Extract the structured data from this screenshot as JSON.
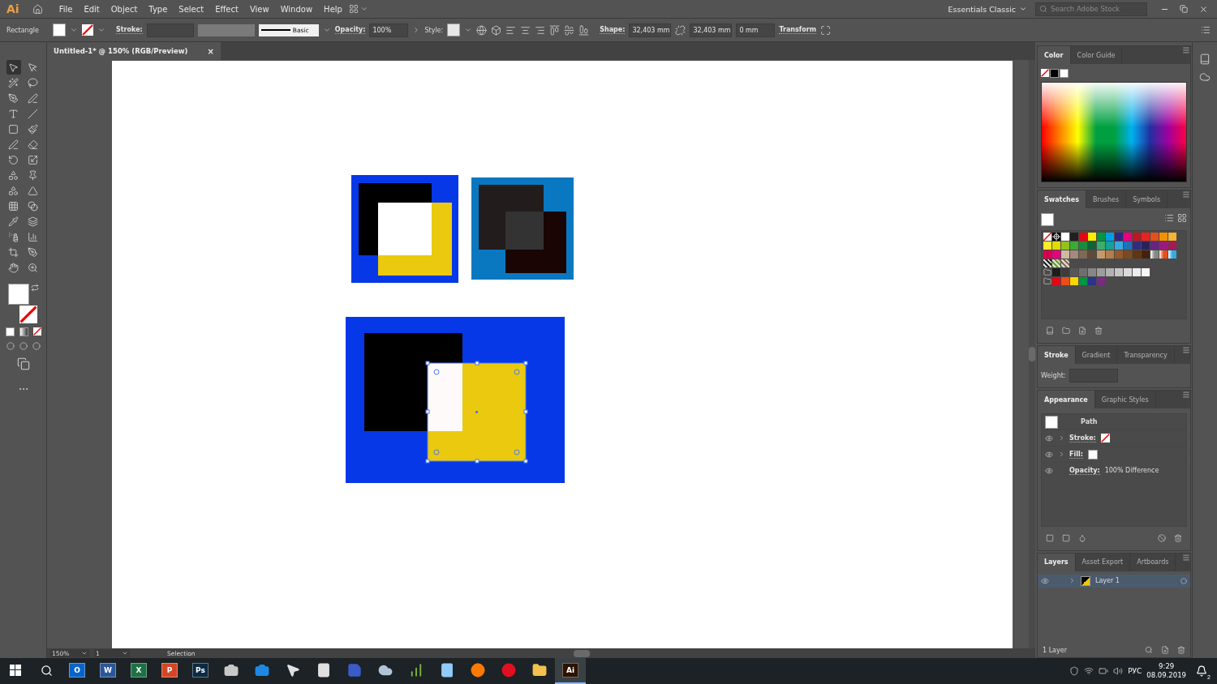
{
  "app": {
    "logo": "Ai",
    "menu": [
      "File",
      "Edit",
      "Object",
      "Type",
      "Select",
      "Effect",
      "View",
      "Window",
      "Help"
    ],
    "workspace": "Essentials Classic",
    "search": {
      "placeholder": "Search Adobe Stock"
    }
  },
  "control_bar": {
    "object_type": "Rectangle",
    "stroke_label": "Stroke:",
    "brush": "Basic",
    "opacity_label": "Opacity:",
    "opacity": "100%",
    "style_label": "Style:",
    "shape_label": "Shape:",
    "width": "32,403 mm",
    "height": "32,403 mm",
    "corner": "0 mm",
    "transform": "Transform"
  },
  "document_tab": {
    "title": "Untitled-1* @ 150% (RGB/Preview)",
    "close": "×"
  },
  "color_panel": {
    "tabs": [
      {
        "label": "Color",
        "selected": true
      },
      {
        "label": "Color Guide",
        "selected": false
      }
    ]
  },
  "swatches_panel": {
    "tabs": [
      {
        "label": "Swatches",
        "selected": true
      },
      {
        "label": "Brushes",
        "selected": false
      },
      {
        "label": "Symbols",
        "selected": false
      }
    ],
    "rows": [
      {
        "kind": "plain",
        "swatches": [
          {
            "kind": "none",
            "color": "#ffffff"
          },
          {
            "kind": "registration",
            "color": "#000000"
          },
          {
            "kind": "solid",
            "color": "#ffffff"
          },
          {
            "kind": "solid",
            "color": "#231f20"
          },
          {
            "kind": "solid",
            "color": "#e30613"
          },
          {
            "kind": "solid",
            "color": "#ffed00"
          },
          {
            "kind": "solid",
            "color": "#009640"
          },
          {
            "kind": "solid",
            "color": "#009fe3"
          },
          {
            "kind": "solid",
            "color": "#312783"
          },
          {
            "kind": "solid",
            "color": "#e6007e"
          },
          {
            "kind": "solid",
            "color": "#be1622"
          },
          {
            "kind": "solid",
            "color": "#e52521"
          },
          {
            "kind": "solid",
            "color": "#e94e1b"
          },
          {
            "kind": "solid",
            "color": "#f39200"
          },
          {
            "kind": "solid",
            "color": "#f9b233"
          }
        ]
      },
      {
        "kind": "plain",
        "swatches": [
          {
            "kind": "solid",
            "color": "#fcea2b"
          },
          {
            "kind": "solid",
            "color": "#dedc00"
          },
          {
            "kind": "solid",
            "color": "#95c11f"
          },
          {
            "kind": "solid",
            "color": "#3aaa35"
          },
          {
            "kind": "solid",
            "color": "#1d8a3c"
          },
          {
            "kind": "solid",
            "color": "#0f6437"
          },
          {
            "kind": "solid",
            "color": "#3eac6f"
          },
          {
            "kind": "solid",
            "color": "#16a19b"
          },
          {
            "kind": "solid",
            "color": "#36a9e1"
          },
          {
            "kind": "solid",
            "color": "#1d71b8"
          },
          {
            "kind": "solid",
            "color": "#2d2e83"
          },
          {
            "kind": "solid",
            "color": "#29235c"
          },
          {
            "kind": "solid",
            "color": "#662483"
          },
          {
            "kind": "solid",
            "color": "#951b81"
          },
          {
            "kind": "solid",
            "color": "#a3195b"
          }
        ]
      },
      {
        "kind": "plain",
        "swatches": [
          {
            "kind": "solid",
            "color": "#d6004f"
          },
          {
            "kind": "solid",
            "color": "#e6007e"
          },
          {
            "kind": "solid",
            "color": "#cbbba0"
          },
          {
            "kind": "solid",
            "color": "#a48a7b"
          },
          {
            "kind": "solid",
            "color": "#7c6a55"
          },
          {
            "kind": "solid",
            "color": "#5f4b3c"
          },
          {
            "kind": "solid",
            "color": "#c49a6c"
          },
          {
            "kind": "solid",
            "color": "#b17f4a"
          },
          {
            "kind": "solid",
            "color": "#955a2a"
          },
          {
            "kind": "solid",
            "color": "#7a4a22"
          },
          {
            "kind": "solid",
            "color": "#623412"
          },
          {
            "kind": "solid",
            "color": "#42220f"
          },
          {
            "kind": "gradient",
            "color": "#888888"
          },
          {
            "kind": "gradient",
            "color": "#e94e1b"
          },
          {
            "kind": "gradient",
            "color": "#36a9e1"
          }
        ]
      },
      {
        "kind": "plain",
        "swatches": [
          {
            "kind": "pattern",
            "color": "#222222"
          },
          {
            "kind": "pattern",
            "color": "#6aa02a"
          },
          {
            "kind": "pattern",
            "color": "#8a6a50"
          }
        ]
      },
      {
        "kind": "group",
        "swatches": [
          {
            "kind": "solid",
            "color": "#1d1d1b"
          },
          {
            "kind": "solid",
            "color": "#3c3c3b"
          },
          {
            "kind": "solid",
            "color": "#575756"
          },
          {
            "kind": "solid",
            "color": "#706f6f"
          },
          {
            "kind": "solid",
            "color": "#878787"
          },
          {
            "kind": "solid",
            "color": "#9d9d9c"
          },
          {
            "kind": "solid",
            "color": "#b2b2b2"
          },
          {
            "kind": "solid",
            "color": "#c6c6c6"
          },
          {
            "kind": "solid",
            "color": "#dadada"
          },
          {
            "kind": "solid",
            "color": "#ededed"
          },
          {
            "kind": "solid",
            "color": "#f6f6f6"
          }
        ]
      },
      {
        "kind": "group",
        "swatches": [
          {
            "kind": "solid",
            "color": "#e30613"
          },
          {
            "kind": "solid",
            "color": "#e94e1b"
          },
          {
            "kind": "solid",
            "color": "#fcd600"
          },
          {
            "kind": "solid",
            "color": "#009640"
          },
          {
            "kind": "solid",
            "color": "#2a348c"
          },
          {
            "kind": "solid",
            "color": "#7b2a82"
          }
        ]
      }
    ]
  },
  "stroke_panel": {
    "tabs": [
      {
        "label": "Stroke",
        "selected": true
      },
      {
        "label": "Gradient",
        "selected": false
      },
      {
        "label": "Transparency",
        "selected": false
      }
    ],
    "weight_label": "Weight:"
  },
  "appearance_panel": {
    "tabs": [
      {
        "label": "Appearance",
        "selected": true
      },
      {
        "label": "Graphic Styles",
        "selected": false
      }
    ],
    "title": "Path",
    "rows": [
      {
        "kind": "stroke",
        "label": "Stroke:"
      },
      {
        "kind": "fill",
        "label": "Fill:"
      },
      {
        "kind": "opacity",
        "label": "Opacity:",
        "value": "100% Difference"
      }
    ]
  },
  "layers_panel": {
    "tabs": [
      {
        "label": "Layers",
        "selected": true
      },
      {
        "label": "Asset Export",
        "selected": false
      },
      {
        "label": "Artboards",
        "selected": false
      }
    ],
    "layers": [
      {
        "name": "Layer 1",
        "selected": true
      }
    ],
    "count": "1 Layer"
  },
  "status_bar": {
    "zoom": "150%",
    "artboard": "1",
    "tool": "Selection"
  },
  "taskbar": {
    "apps": [
      {
        "kind": "tile",
        "label": "O",
        "color": "#0a64c8",
        "selected": false
      },
      {
        "kind": "tile",
        "label": "W",
        "color": "#2b5797",
        "selected": false
      },
      {
        "kind": "tile",
        "label": "X",
        "color": "#1e7145",
        "selected": false
      },
      {
        "kind": "tile",
        "label": "P",
        "color": "#d24726",
        "selected": false
      },
      {
        "kind": "tile",
        "label": "Ps",
        "color": "#0b2a45",
        "selected": false
      },
      {
        "kind": "camera",
        "color": "#c8c8c8",
        "selected": false
      },
      {
        "kind": "camera",
        "color": "#1e88e5",
        "selected": false
      },
      {
        "kind": "pointer",
        "color": "#e0e0e0",
        "selected": false
      },
      {
        "kind": "calculator",
        "color": "#e0e0e0",
        "selected": false
      },
      {
        "kind": "disk",
        "color": "#3a5cc8",
        "selected": false
      },
      {
        "kind": "cloud",
        "color": "#b0c4d8",
        "selected": false
      },
      {
        "kind": "chart",
        "color": "#7cb342",
        "selected": false
      },
      {
        "kind": "book",
        "color": "#90caf9",
        "selected": false
      },
      {
        "kind": "globe",
        "color": "#ff7a00",
        "selected": false
      },
      {
        "kind": "ring",
        "color": "#e01020",
        "selected": false
      },
      {
        "kind": "folder",
        "color": "#f2c14e",
        "selected": false
      },
      {
        "kind": "tile",
        "label": "Ai",
        "color": "#2b1300",
        "selected": true
      }
    ],
    "language": "РУС",
    "time": "9:29",
    "date": "08.09.2019",
    "notifications": "2"
  }
}
